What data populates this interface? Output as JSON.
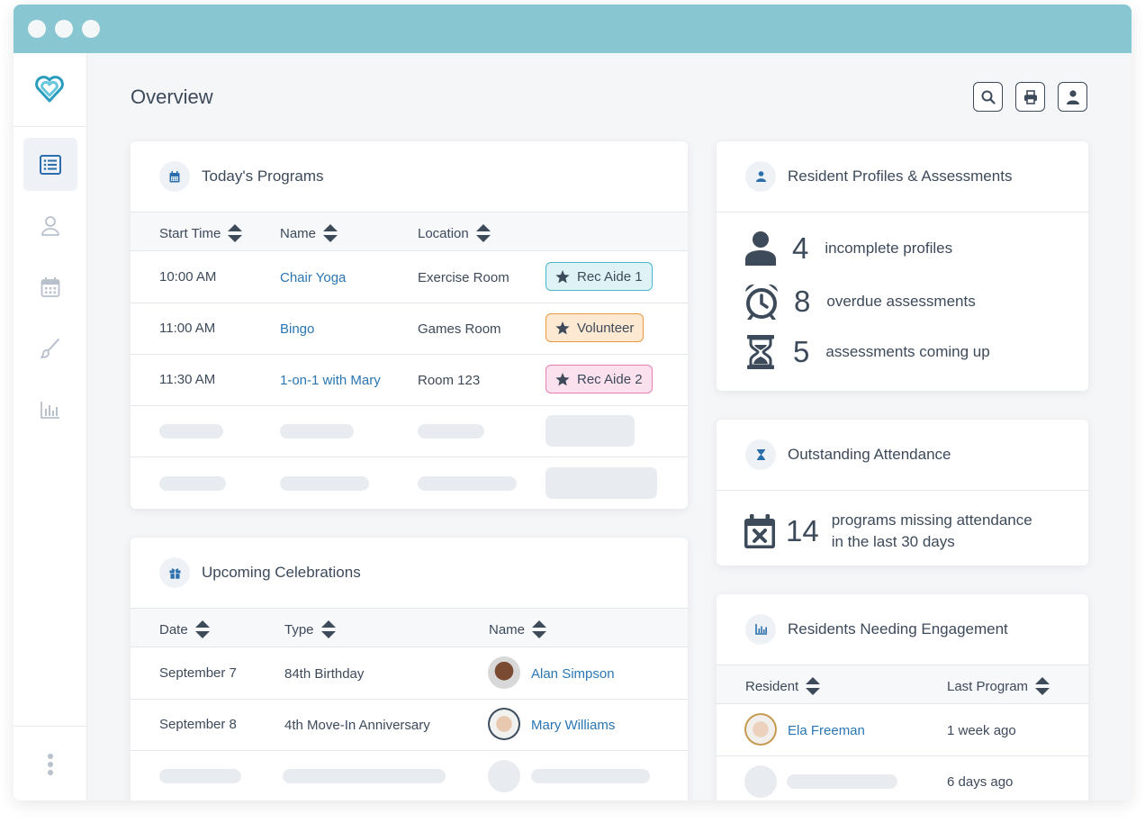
{
  "colors": {
    "titlebar": "#88c6d1",
    "accent": "#2a76b3",
    "text": "#3d4a5a",
    "teal_tag": "#47b8c9",
    "orange_tag": "#e99a3c",
    "pink_tag": "#e57fb1"
  },
  "page": {
    "title": "Overview"
  },
  "header_buttons": [
    {
      "icon": "search-icon"
    },
    {
      "icon": "printer-icon"
    },
    {
      "icon": "user-icon"
    }
  ],
  "sidebar": {
    "items": [
      {
        "icon": "list-icon",
        "active": true
      },
      {
        "icon": "user-icon"
      },
      {
        "icon": "calendar-icon"
      },
      {
        "icon": "brush-icon"
      },
      {
        "icon": "bar-chart-icon"
      }
    ],
    "more": {
      "icon": "more-vertical-icon"
    }
  },
  "programs": {
    "title": "Today's Programs",
    "columns": [
      "Start Time",
      "Name",
      "Location"
    ],
    "rows": [
      {
        "time": "10:00 AM",
        "name": "Chair Yoga",
        "location": "Exercise Room",
        "staff": "Rec Aide 1",
        "tag_color": "teal"
      },
      {
        "time": "11:00 AM",
        "name": "Bingo",
        "location": "Games Room",
        "staff": "Volunteer",
        "tag_color": "orange"
      },
      {
        "time": "11:30 AM",
        "name": "1-on-1 with Mary",
        "location": "Room 123",
        "staff": "Rec Aide 2",
        "tag_color": "pink"
      }
    ]
  },
  "celebrations": {
    "title": "Upcoming Celebrations",
    "columns": [
      "Date",
      "Type",
      "Name"
    ],
    "rows": [
      {
        "date": "September 7",
        "type": "84th Birthday",
        "name": "Alan Simpson"
      },
      {
        "date": "September 8",
        "type": "4th Move-In Anniversary",
        "name": "Mary Williams"
      }
    ]
  },
  "profiles": {
    "title": "Resident Profiles & Assessments",
    "stats": [
      {
        "icon": "user-icon",
        "value": "4",
        "label": "incomplete profiles"
      },
      {
        "icon": "alarm-clock-icon",
        "value": "8",
        "label": "overdue assessments"
      },
      {
        "icon": "hourglass-icon",
        "value": "5",
        "label": "assessments coming up"
      }
    ]
  },
  "attendance": {
    "title": "Outstanding Attendance",
    "value": "14",
    "label_line1": "programs missing attendance",
    "label_line2": "in the last 30 days"
  },
  "engagement": {
    "title": "Residents Needing Engagement",
    "columns": [
      "Resident",
      "Last Program"
    ],
    "rows": [
      {
        "resident": "Ela Freeman",
        "last": "1 week ago"
      },
      {
        "resident": "",
        "last": "6 days ago"
      }
    ]
  }
}
